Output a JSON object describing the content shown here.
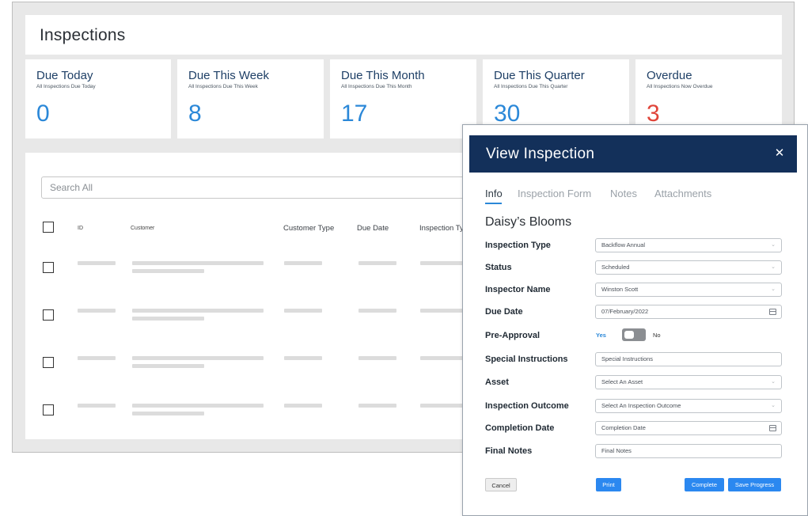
{
  "page": {
    "title": "Inspections"
  },
  "stats": [
    {
      "title": "Due Today",
      "subtitle": "All Inspections Due Today",
      "value": "0"
    },
    {
      "title": "Due This Week",
      "subtitle": "All Inspections Due This Week",
      "value": "8"
    },
    {
      "title": "Due This Month",
      "subtitle": "All Inspections Due This Month",
      "value": "17"
    },
    {
      "title": "Due This Quarter",
      "subtitle": "All Inspections Due This Quarter",
      "value": "30"
    },
    {
      "title": "Overdue",
      "subtitle": "All Inspections Now Overdue",
      "value": "3"
    }
  ],
  "list": {
    "search_placeholder": "Search All",
    "columns": [
      "ID",
      "Customer",
      "Customer Type",
      "Due Date",
      "Inspection Typ"
    ]
  },
  "colors": {
    "accent": "#2b88d8",
    "overdue": "#e0453a",
    "modal_header": "#13305a",
    "button": "#2b88f0"
  },
  "modal": {
    "title": "View Inspection",
    "close_icon": "close-icon",
    "tabs": [
      "Info",
      "Inspection Form",
      "Notes",
      "Attachments"
    ],
    "active_tab": "Info",
    "customer": "Daisy’s Blooms",
    "fields": {
      "inspection_type": {
        "label": "Inspection Type",
        "value": "Backflow Annual"
      },
      "status": {
        "label": "Status",
        "value": "Scheduled"
      },
      "inspector_name": {
        "label": "Inspector Name",
        "value": "Winston Scott"
      },
      "due_date": {
        "label": "Due Date",
        "value": "07/February/2022"
      },
      "pre_approval": {
        "label": "Pre-Approval",
        "yes": "Yes",
        "no": "No"
      },
      "special_instructions": {
        "label": "Special Instructions",
        "placeholder": "Special Instructions"
      },
      "asset": {
        "label": "Asset",
        "placeholder": "Select An Asset"
      },
      "inspection_outcome": {
        "label": "Inspection Outcome",
        "placeholder": "Select An Inspection Outcome"
      },
      "completion_date": {
        "label": "Completion Date",
        "placeholder": "Completion Date"
      },
      "final_notes": {
        "label": "Final Notes",
        "placeholder": "Final Notes"
      }
    },
    "buttons": {
      "cancel": "Cancel",
      "print": "Print",
      "complete": "Complete",
      "save_progress": "Save Progress"
    }
  }
}
